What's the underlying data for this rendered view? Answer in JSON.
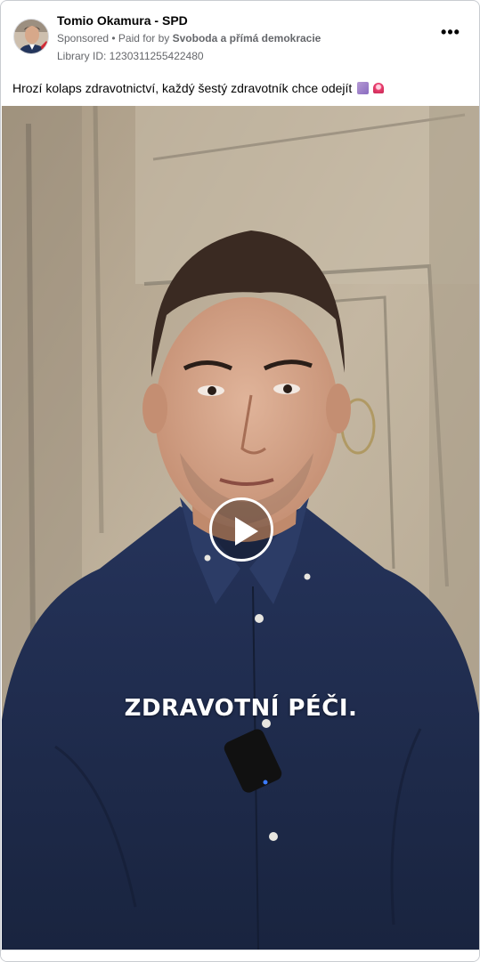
{
  "post": {
    "page_name": "Tomio Okamura - SPD",
    "sponsored": "Sponsored",
    "separator": " • ",
    "paid_for_prefix": "Paid for by ",
    "paid_for_by": "Svoboda a přímá demokracie",
    "library_id": "Library ID: 1230311255422480",
    "caption": "Hrozí kolaps zdravotnictví, každý šestý zdravotník chce odejít",
    "caption_emojis": [
      "scroll-flyer-icon",
      "siren-icon"
    ],
    "more_icon": "more-options-icon"
  },
  "video": {
    "subtitle": "ZDRAVOTNÍ PÉČI.",
    "play_icon": "play-icon"
  },
  "colors": {
    "text_primary": "#050505",
    "text_secondary": "#65676b",
    "border": "#c9ccd1",
    "shirt": "#1f2d4a",
    "wall": "#b9ab96"
  }
}
